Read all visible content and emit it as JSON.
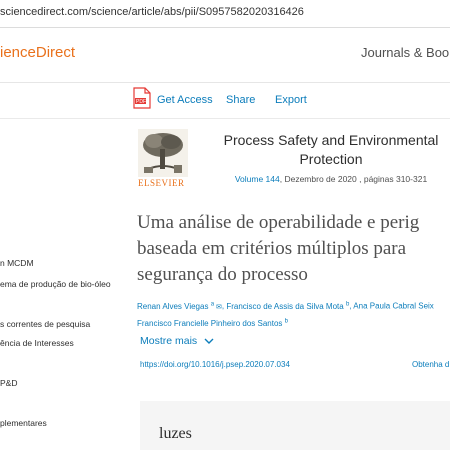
{
  "browser": {
    "url": "sciencedirect.com/science/article/abs/pii/S0957582020316426"
  },
  "header": {
    "brand": "ienceDirect",
    "journals_link": "Journals & Books"
  },
  "toolbar": {
    "get_access": "Get Access",
    "share": "Share",
    "export": "Export",
    "pdf_icon": "pdf-icon"
  },
  "sidebar": {
    "items": [
      {
        "label": "n MCDM"
      },
      {
        "label": "ema de produção de bio-óleo"
      },
      {
        "label": "s correntes de pesquisa"
      },
      {
        "label": "ência de Interesses"
      },
      {
        "label": "P&D"
      },
      {
        "label": "plementares"
      }
    ]
  },
  "journal": {
    "publisher": "ELSEVIER",
    "title": "Process Safety and Environmental Protection",
    "volume": "Volume 144",
    "volume_rest": ", Dezembro de 2020 , páginas 310-321"
  },
  "article": {
    "title_line1": "Uma análise de operabilidade e perig",
    "title_line2": "baseada em critérios múltiplos para",
    "title_line3": "segurança do processo",
    "authors": [
      {
        "name": "Renan Alves Viegas",
        "sup": "a",
        "extra": " ✉"
      },
      {
        "name": "Francisco de Assis da Silva Mota",
        "sup": "b",
        "extra": ""
      },
      {
        "name": "Ana Paula Cabral Seix",
        "sup": "",
        "extra": ""
      },
      {
        "name": "Francisco Francielle Pinheiro dos Santos",
        "sup": "b",
        "extra": ""
      }
    ],
    "show_more": "Mostre mais",
    "doi": "https://doi.org/10.1016/j.psep.2020.07.034",
    "rights": "Obtenha d"
  },
  "highlights": {
    "title": "luzes"
  },
  "colors": {
    "brand": "#e9711c",
    "link": "#0c7dbb",
    "text": "#2e2e2e"
  }
}
